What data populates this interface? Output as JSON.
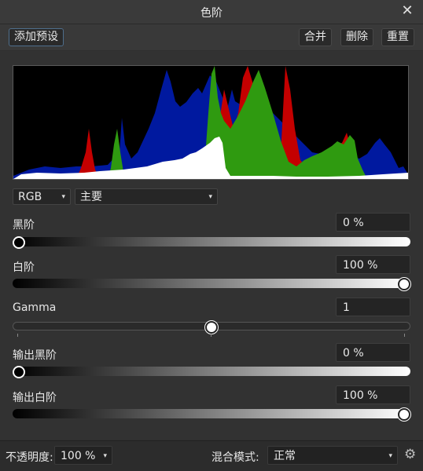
{
  "window": {
    "title": "色阶",
    "close_glyph": "✕",
    "close_icon": "close-icon"
  },
  "toolbar": {
    "add_preset": "添加预设",
    "merge": "合并",
    "delete": "删除",
    "reset": "重置"
  },
  "channel": {
    "selected": "RGB",
    "mode": "主要",
    "arrow": "▾"
  },
  "histogram": {
    "colors": {
      "red": "#c40000",
      "green": "#2f9a10",
      "blue": "#001aa8",
      "white": "#ffffff"
    }
  },
  "controls": {
    "black": {
      "label": "黑阶",
      "value": "0 %",
      "level": 0
    },
    "white": {
      "label": "白阶",
      "value": "100 %",
      "level": 1
    },
    "gamma": {
      "label": "Gamma",
      "value": "1",
      "level": 0.5
    },
    "out_black": {
      "label": "输出黑阶",
      "value": "0 %",
      "level": 0
    },
    "out_white": {
      "label": "输出白阶",
      "value": "100 %",
      "level": 1
    }
  },
  "footer": {
    "opacity_label": "不透明度:",
    "opacity_value": "100 %",
    "blend_label": "混合模式:",
    "blend_value": "正常",
    "settings_icon": "gear-icon",
    "gear_glyph": "⚙"
  }
}
